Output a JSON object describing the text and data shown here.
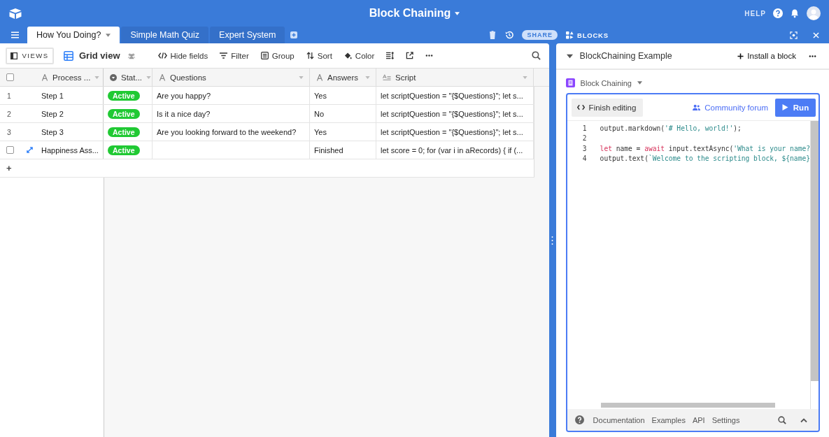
{
  "app": {
    "title": "Block Chaining",
    "help": "HELP"
  },
  "tables": [
    {
      "label": "How You Doing?",
      "selected": true
    },
    {
      "label": "Simple Math Quiz",
      "selected": false
    },
    {
      "label": "Expert System",
      "selected": false
    }
  ],
  "share": "SHARE",
  "toolbar": {
    "views": "VIEWS",
    "view_name": "Grid view",
    "actions": [
      {
        "label": "Hide fields",
        "kind": "hide"
      },
      {
        "label": "Filter",
        "kind": "filter"
      },
      {
        "label": "Group",
        "kind": "group"
      },
      {
        "label": "Sort",
        "kind": "sort"
      },
      {
        "label": "Color",
        "kind": "color"
      }
    ]
  },
  "select_all": {
    "checked": false
  },
  "columns": [
    {
      "label": "Process ...",
      "kind": "text"
    },
    {
      "label": "Stat...",
      "kind": "select"
    },
    {
      "label": "Questions",
      "kind": "text"
    },
    {
      "label": "Answers",
      "kind": "text"
    },
    {
      "label": "Script",
      "kind": "longtext"
    }
  ],
  "rows": [
    {
      "number": "1",
      "cells": [
        "Step 1",
        "Active",
        "Are you happy?",
        "Yes",
        "let scriptQuestion = \"{$Questions}\"; let s..."
      ]
    },
    {
      "number": "2",
      "cells": [
        "Step 2",
        "Active",
        "Is it a nice day?",
        "No",
        "let scriptQuestion = \"{$Questions}\"; let s..."
      ]
    },
    {
      "number": "3",
      "cells": [
        "Step 3",
        "Active",
        "Are you looking forward to the weekend?",
        "Yes",
        "let scriptQuestion = \"{$Questions}\"; let s..."
      ]
    },
    {
      "checked": false,
      "cells": [
        "Happiness Ass...",
        "Active",
        "",
        "Finished",
        "let score = 0; for (var i in aRecords) { if (..."
      ]
    }
  ],
  "add_row": "+",
  "blocks": {
    "label": "BLOCKS",
    "title": "BlockChaining Example",
    "install": "Install a block",
    "block_name": "Block Chaining",
    "finish": "Finish editing",
    "community": "Community forum",
    "run": "Run",
    "code": [
      {
        "number": "1",
        "tokens": [
          {
            "text": "output.markdown(",
            "kind": "plain"
          },
          {
            "text": "'# Hello, world!'",
            "kind": "string"
          },
          {
            "text": ");",
            "kind": "plain"
          }
        ]
      },
      {
        "number": "2"
      },
      {
        "number": "3",
        "tokens": [
          {
            "text": "let",
            "kind": "keyword"
          },
          {
            "text": " name = ",
            "kind": "plain"
          },
          {
            "text": "await",
            "kind": "keyword"
          },
          {
            "text": " input.textAsync(",
            "kind": "plain"
          },
          {
            "text": "'What is your name?",
            "kind": "string"
          }
        ]
      },
      {
        "number": "4",
        "tokens": [
          {
            "text": "output.text(",
            "kind": "plain"
          },
          {
            "text": "`Welcome to the scripting block, ${name}",
            "kind": "string"
          }
        ]
      }
    ],
    "footer": [
      "Documentation",
      "Examples",
      "API",
      "Settings"
    ]
  }
}
